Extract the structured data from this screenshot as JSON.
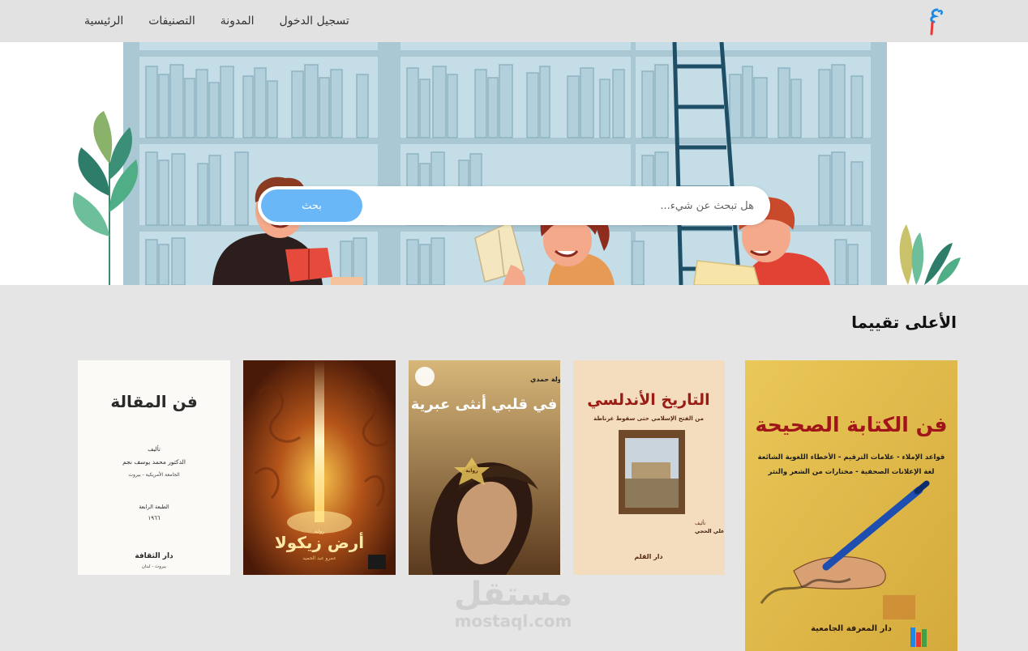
{
  "nav": {
    "items": [
      {
        "label": "الرئيسية"
      },
      {
        "label": "التصنيفات"
      },
      {
        "label": "المدونة"
      },
      {
        "label": "تسجيل الدخول"
      }
    ],
    "logo_color_top": "#1e88e5",
    "logo_color_bottom": "#e53935"
  },
  "search": {
    "placeholder": "هل تبحث عن شيء...",
    "button_label": "بحث"
  },
  "section": {
    "title": "الأعلى تقييما"
  },
  "books": [
    {
      "title": "فن الكتابة الصحيحة",
      "subtitle_lines": [
        "قواعد الإملاء - علامات الترقيم - الأخطاء اللغوية الشائعة",
        "لغة الإعلانات الصحفية - مختارات من الشعر والنثر"
      ],
      "publisher": "دار المعرفة الجامعية",
      "bg": "#e3bd45"
    },
    {
      "title": "التاريخ الأندلسي",
      "subtitle": "من الفتح الإسلامي حتى سقوط غرناطة",
      "author": "د. عبد الرحمن علي الحجي",
      "author_label": "تأليف",
      "publisher": "دار القلم",
      "bg": "#f3dcbf"
    },
    {
      "title": "في قلبي أنثى عبرية",
      "author": "د. خولة حمدي",
      "badge": "رواية",
      "bg": "#b58a4e"
    },
    {
      "title": "أرض زيكولا",
      "author": "عمرو عبد الحميد",
      "label": "رواية",
      "bg": "#8a3f14"
    },
    {
      "title": "فن المقالة",
      "author_label": "تأليف",
      "author": "الدكتور محمد يوسف نجم",
      "affiliation": "الجامعة الأمريكية - بيروت",
      "edition": "الطبعة الرابعة",
      "year": "١٩٦٦",
      "publisher": "دار الثقافة",
      "publisher_city": "بيروت - لبنان",
      "bg": "#fbfaf6"
    }
  ],
  "watermark": {
    "main": "مستقل",
    "sub": "mostaql.com"
  },
  "colors": {
    "hero_shelf": "#b8d4de",
    "hero_book": "#9bc0cf",
    "accent_button": "#6ab7f7"
  }
}
